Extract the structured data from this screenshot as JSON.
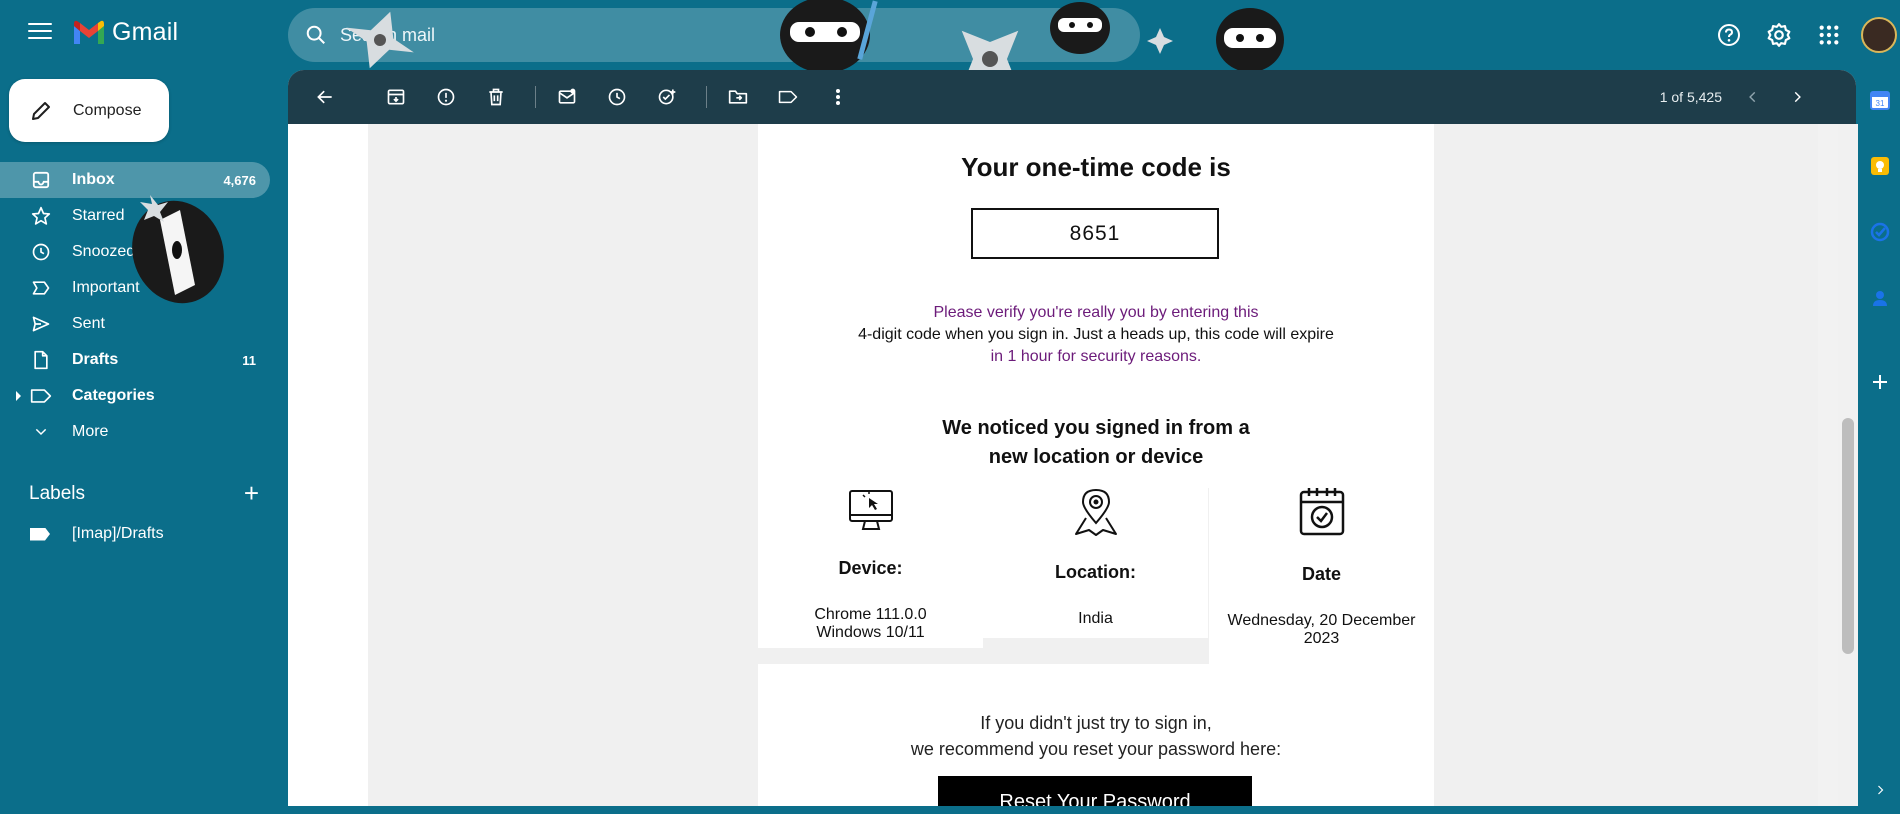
{
  "app": {
    "name": "Gmail"
  },
  "search": {
    "placeholder": "Search mail"
  },
  "compose": {
    "label": "Compose"
  },
  "nav": {
    "items": [
      {
        "label": "Inbox",
        "count": "4,676",
        "icon": "inbox-icon"
      },
      {
        "label": "Starred",
        "count": "",
        "icon": "star-icon"
      },
      {
        "label": "Snoozed",
        "count": "",
        "icon": "clock-icon"
      },
      {
        "label": "Important",
        "count": "",
        "icon": "important-icon"
      },
      {
        "label": "Sent",
        "count": "",
        "icon": "send-icon"
      },
      {
        "label": "Drafts",
        "count": "11",
        "icon": "draft-icon"
      },
      {
        "label": "Categories",
        "count": "",
        "icon": "label-icon"
      },
      {
        "label": "More",
        "count": "",
        "icon": "chevron-down-icon"
      }
    ]
  },
  "labels": {
    "heading": "Labels",
    "items": [
      {
        "label": "[Imap]/Drafts"
      }
    ]
  },
  "toolbar": {
    "pager": "1 of 5,425"
  },
  "email": {
    "otp_title": "Your one-time code is",
    "otp_code": "8651",
    "verify_line1": "Please verify you're really you by entering this",
    "verify_line2": "4-digit code when you sign in. Just a heads up, this code will expire",
    "verify_line3": "in 1 hour for security reasons.",
    "notice_line1": "We noticed you signed in from a",
    "notice_line2": "new location or device",
    "device_title": "Device:",
    "device_line1": "Chrome 111.0.0",
    "device_line2": "Windows 10/11",
    "location_title": "Location:",
    "location_value": "India",
    "date_title": "Date",
    "date_line1": "Wednesday, 20 December",
    "date_line2": "2023",
    "ifnot_line1": "If you didn't just try to sign in,",
    "ifnot_line2": "we recommend you reset your password here:",
    "reset_button": "Reset Your Password"
  },
  "colors": {
    "background": "#0b6e8a",
    "toolbar": "#1e3d4a",
    "verify_text": "#6c1b7a"
  }
}
